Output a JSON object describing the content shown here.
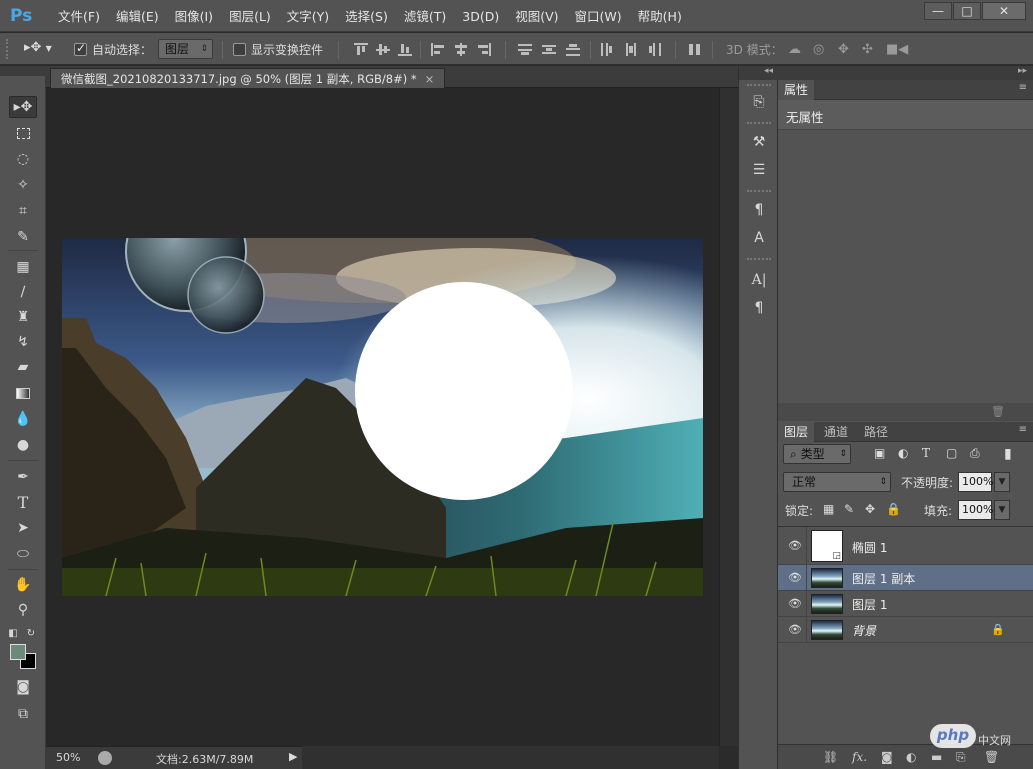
{
  "app": {
    "logo": "Ps"
  },
  "menu": [
    "文件(F)",
    "编辑(E)",
    "图像(I)",
    "图层(L)",
    "文字(Y)",
    "选择(S)",
    "滤镜(T)",
    "3D(D)",
    "视图(V)",
    "窗口(W)",
    "帮助(H)"
  ],
  "window_controls": {
    "minimize": "—",
    "restore": "□",
    "close": "✕"
  },
  "options": {
    "auto_select_label": "自动选择：",
    "auto_select_checked": true,
    "auto_select_value": "图层",
    "show_transform_label": "显示变换控件",
    "show_transform_checked": false,
    "mode3d_label": "3D 模式："
  },
  "document": {
    "tab_title": "微信截图_20210820133717.jpg @ 50% (图层 1 副本, RGB/8#) *",
    "close": "×"
  },
  "status": {
    "zoom": "50%",
    "doc_size": "文档:2.63M/7.89M"
  },
  "properties": {
    "tab": "属性",
    "empty_text": "无属性"
  },
  "layers_panel": {
    "tabs": [
      "图层",
      "通道",
      "路径"
    ],
    "filter_label": "类型",
    "blend_mode": "正常",
    "opacity_label": "不透明度:",
    "opacity_value": "100%",
    "lock_label": "锁定:",
    "fill_label": "填充:",
    "fill_value": "100%",
    "layers": [
      {
        "name": "椭圆 1",
        "selected": false,
        "locked": false
      },
      {
        "name": "图层 1 副本",
        "selected": true,
        "locked": false
      },
      {
        "name": "图层 1",
        "selected": false,
        "locked": false
      },
      {
        "name": "背景",
        "selected": false,
        "locked": true
      }
    ]
  },
  "watermark": {
    "logo": "php",
    "text": "中文网"
  },
  "colors": {
    "foreground": "#6c8a7a",
    "background": "#000000",
    "accent": "#4aa7e8",
    "selected_layer": "#5f6f87"
  }
}
